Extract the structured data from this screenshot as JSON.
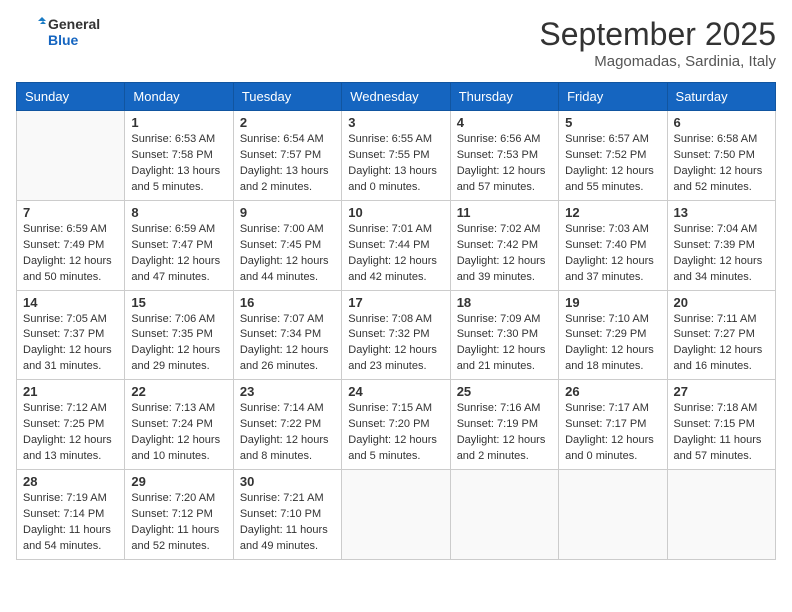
{
  "header": {
    "logo_line1": "General",
    "logo_line2": "Blue",
    "month_year": "September 2025",
    "location": "Magomadas, Sardinia, Italy"
  },
  "weekdays": [
    "Sunday",
    "Monday",
    "Tuesday",
    "Wednesday",
    "Thursday",
    "Friday",
    "Saturday"
  ],
  "weeks": [
    [
      {
        "day": "",
        "info": ""
      },
      {
        "day": "1",
        "info": "Sunrise: 6:53 AM\nSunset: 7:58 PM\nDaylight: 13 hours\nand 5 minutes."
      },
      {
        "day": "2",
        "info": "Sunrise: 6:54 AM\nSunset: 7:57 PM\nDaylight: 13 hours\nand 2 minutes."
      },
      {
        "day": "3",
        "info": "Sunrise: 6:55 AM\nSunset: 7:55 PM\nDaylight: 13 hours\nand 0 minutes."
      },
      {
        "day": "4",
        "info": "Sunrise: 6:56 AM\nSunset: 7:53 PM\nDaylight: 12 hours\nand 57 minutes."
      },
      {
        "day": "5",
        "info": "Sunrise: 6:57 AM\nSunset: 7:52 PM\nDaylight: 12 hours\nand 55 minutes."
      },
      {
        "day": "6",
        "info": "Sunrise: 6:58 AM\nSunset: 7:50 PM\nDaylight: 12 hours\nand 52 minutes."
      }
    ],
    [
      {
        "day": "7",
        "info": "Sunrise: 6:59 AM\nSunset: 7:49 PM\nDaylight: 12 hours\nand 50 minutes."
      },
      {
        "day": "8",
        "info": "Sunrise: 6:59 AM\nSunset: 7:47 PM\nDaylight: 12 hours\nand 47 minutes."
      },
      {
        "day": "9",
        "info": "Sunrise: 7:00 AM\nSunset: 7:45 PM\nDaylight: 12 hours\nand 44 minutes."
      },
      {
        "day": "10",
        "info": "Sunrise: 7:01 AM\nSunset: 7:44 PM\nDaylight: 12 hours\nand 42 minutes."
      },
      {
        "day": "11",
        "info": "Sunrise: 7:02 AM\nSunset: 7:42 PM\nDaylight: 12 hours\nand 39 minutes."
      },
      {
        "day": "12",
        "info": "Sunrise: 7:03 AM\nSunset: 7:40 PM\nDaylight: 12 hours\nand 37 minutes."
      },
      {
        "day": "13",
        "info": "Sunrise: 7:04 AM\nSunset: 7:39 PM\nDaylight: 12 hours\nand 34 minutes."
      }
    ],
    [
      {
        "day": "14",
        "info": "Sunrise: 7:05 AM\nSunset: 7:37 PM\nDaylight: 12 hours\nand 31 minutes."
      },
      {
        "day": "15",
        "info": "Sunrise: 7:06 AM\nSunset: 7:35 PM\nDaylight: 12 hours\nand 29 minutes."
      },
      {
        "day": "16",
        "info": "Sunrise: 7:07 AM\nSunset: 7:34 PM\nDaylight: 12 hours\nand 26 minutes."
      },
      {
        "day": "17",
        "info": "Sunrise: 7:08 AM\nSunset: 7:32 PM\nDaylight: 12 hours\nand 23 minutes."
      },
      {
        "day": "18",
        "info": "Sunrise: 7:09 AM\nSunset: 7:30 PM\nDaylight: 12 hours\nand 21 minutes."
      },
      {
        "day": "19",
        "info": "Sunrise: 7:10 AM\nSunset: 7:29 PM\nDaylight: 12 hours\nand 18 minutes."
      },
      {
        "day": "20",
        "info": "Sunrise: 7:11 AM\nSunset: 7:27 PM\nDaylight: 12 hours\nand 16 minutes."
      }
    ],
    [
      {
        "day": "21",
        "info": "Sunrise: 7:12 AM\nSunset: 7:25 PM\nDaylight: 12 hours\nand 13 minutes."
      },
      {
        "day": "22",
        "info": "Sunrise: 7:13 AM\nSunset: 7:24 PM\nDaylight: 12 hours\nand 10 minutes."
      },
      {
        "day": "23",
        "info": "Sunrise: 7:14 AM\nSunset: 7:22 PM\nDaylight: 12 hours\nand 8 minutes."
      },
      {
        "day": "24",
        "info": "Sunrise: 7:15 AM\nSunset: 7:20 PM\nDaylight: 12 hours\nand 5 minutes."
      },
      {
        "day": "25",
        "info": "Sunrise: 7:16 AM\nSunset: 7:19 PM\nDaylight: 12 hours\nand 2 minutes."
      },
      {
        "day": "26",
        "info": "Sunrise: 7:17 AM\nSunset: 7:17 PM\nDaylight: 12 hours\nand 0 minutes."
      },
      {
        "day": "27",
        "info": "Sunrise: 7:18 AM\nSunset: 7:15 PM\nDaylight: 11 hours\nand 57 minutes."
      }
    ],
    [
      {
        "day": "28",
        "info": "Sunrise: 7:19 AM\nSunset: 7:14 PM\nDaylight: 11 hours\nand 54 minutes."
      },
      {
        "day": "29",
        "info": "Sunrise: 7:20 AM\nSunset: 7:12 PM\nDaylight: 11 hours\nand 52 minutes."
      },
      {
        "day": "30",
        "info": "Sunrise: 7:21 AM\nSunset: 7:10 PM\nDaylight: 11 hours\nand 49 minutes."
      },
      {
        "day": "",
        "info": ""
      },
      {
        "day": "",
        "info": ""
      },
      {
        "day": "",
        "info": ""
      },
      {
        "day": "",
        "info": ""
      }
    ]
  ]
}
